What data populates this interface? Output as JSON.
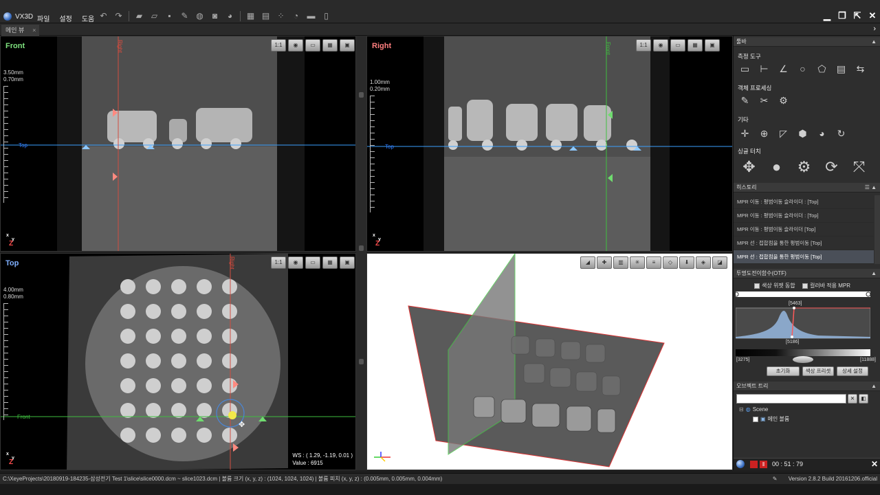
{
  "app": {
    "name": "VX3D"
  },
  "menu": [
    "파일",
    "설정",
    "도움"
  ],
  "toolbar_icons": [
    "undo-icon",
    "redo-icon",
    "open-icon",
    "open-folder-icon",
    "save-icon",
    "pen-icon",
    "globe-icon",
    "camera-icon",
    "capture-icon",
    "grid-icon",
    "layout-icon",
    "dots-icon",
    "refresh-icon",
    "print-icon",
    "document-icon"
  ],
  "tabs": [
    {
      "label": "메인 뷰"
    }
  ],
  "views": {
    "front": {
      "label": "Front",
      "label_color": "#7fe37f",
      "scale1": "3.50mm",
      "scale2": "0.70mm",
      "cross_label_v": "Right",
      "cross_label_h": "Top"
    },
    "right": {
      "label": "Right",
      "label_color": "#ff7f7f",
      "scale1": "1.00mm",
      "scale2": "0.20mm",
      "cross_label_v": "Front",
      "cross_label_h": "Top"
    },
    "top": {
      "label": "Top",
      "label_color": "#7fb0ff",
      "scale1": "4.00mm",
      "scale2": "0.80mm",
      "cross_label_v": "Right",
      "cross_label_h": "Front",
      "ws_line": "WS : ( 1.29, -1.19, 0.01 )",
      "value_line": "Value : 6915"
    }
  },
  "view_tools": [
    "1:1",
    "◉",
    "▭",
    "▦",
    "▣"
  ],
  "view3d_tools": [
    "◢",
    "✚",
    "▥",
    "✳",
    "≡",
    "◇",
    "⬇",
    "◈",
    "◪"
  ],
  "panel": {
    "toolbar_title": "툴바",
    "measure_title": "측정 도구",
    "measure_icons": [
      "ruler-icon",
      "distance-icon",
      "angle-icon",
      "circle-icon",
      "polygon-icon",
      "note-icon",
      "link-icon"
    ],
    "object_title": "객체 프로세싱",
    "object_icons": [
      "brush-icon",
      "cut-icon",
      "transform-icon"
    ],
    "other_title": "기타",
    "other_icons": [
      "grid-point-icon",
      "zoom-region-icon",
      "crop-icon",
      "box-icon",
      "render-icon",
      "reset-icon"
    ],
    "touch_title": "싱글 터치",
    "touch_icons": [
      "move-icon",
      "zoom-icon",
      "gear-icon",
      "rotate-icon",
      "rotate-axis-icon"
    ],
    "history_title": "히스토리",
    "history": [
      "MPR 이동 : 평범이동 슬라이더 : [Top]",
      "MPR 이동 : 평범이동 슬라이더 : [Top]",
      "MPR 이동 : 평범이동 슬라이더 [Top]",
      "MPR 선 : 접합점을 통한 평범이동 [Top]",
      "MPR 선 : 접합점을 통한 평범이동 [Top]"
    ],
    "otf_title": "투명도전이함수(OTF)",
    "otf_check1": "색상 위젯 동합",
    "otf_check2": "컬러바 적용 MPR",
    "otf_top": "[5463]",
    "otf_bottom": "[5186]",
    "otf_min": "[3275]",
    "otf_max": "[11888]",
    "btn_reset": "초기화",
    "btn_preset": "색상 프리셋",
    "btn_detail": "상세 설정",
    "objtree_title": "오브젝트 트리",
    "tree_scene": "Scene",
    "tree_volume": "메인 볼륨",
    "timer": "00 : 51 : 79"
  },
  "status": {
    "path": "C:\\XeyeProjects\\20180919-184235-삼성전기 Test 1\\slice\\slice0000.dcm ~ slice1023.dcm",
    "volume_size": "볼륨 크기 (x, y, z) : (1024, 1024, 1024)",
    "volume_pitch": "볼륨 피치 (x, y, z) : (0.005mm, 0.005mm, 0.004mm)",
    "version": "Version 2.8.2 Build 20161206.official"
  }
}
